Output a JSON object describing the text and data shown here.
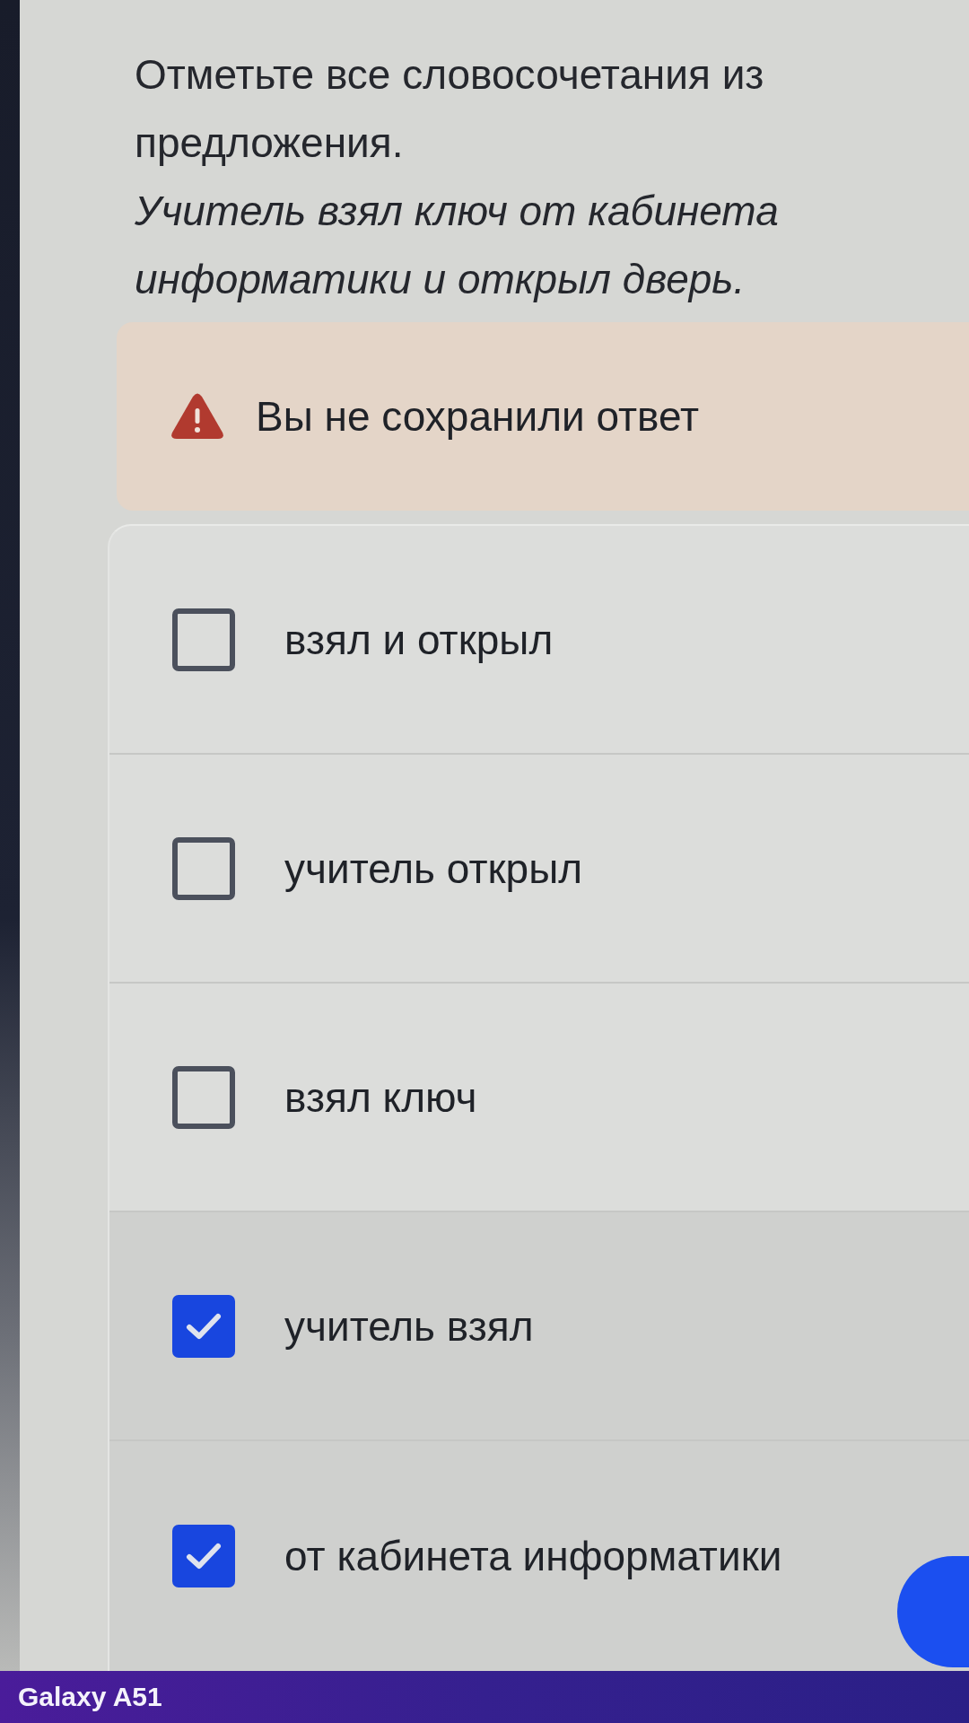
{
  "instruction": "Отметьте все словосочетания из предложения.",
  "sentence": "Учитель взял ключ от кабинета информатики и открыл дверь.",
  "warning": {
    "text": "Вы не сохранили ответ"
  },
  "options": [
    {
      "label": "взял и открыл",
      "checked": false
    },
    {
      "label": "учитель открыл",
      "checked": false
    },
    {
      "label": "взял ключ",
      "checked": false
    },
    {
      "label": "учитель взял",
      "checked": true
    },
    {
      "label": "от кабинета информатики",
      "checked": true
    }
  ],
  "device_label": "Galaxy A51"
}
